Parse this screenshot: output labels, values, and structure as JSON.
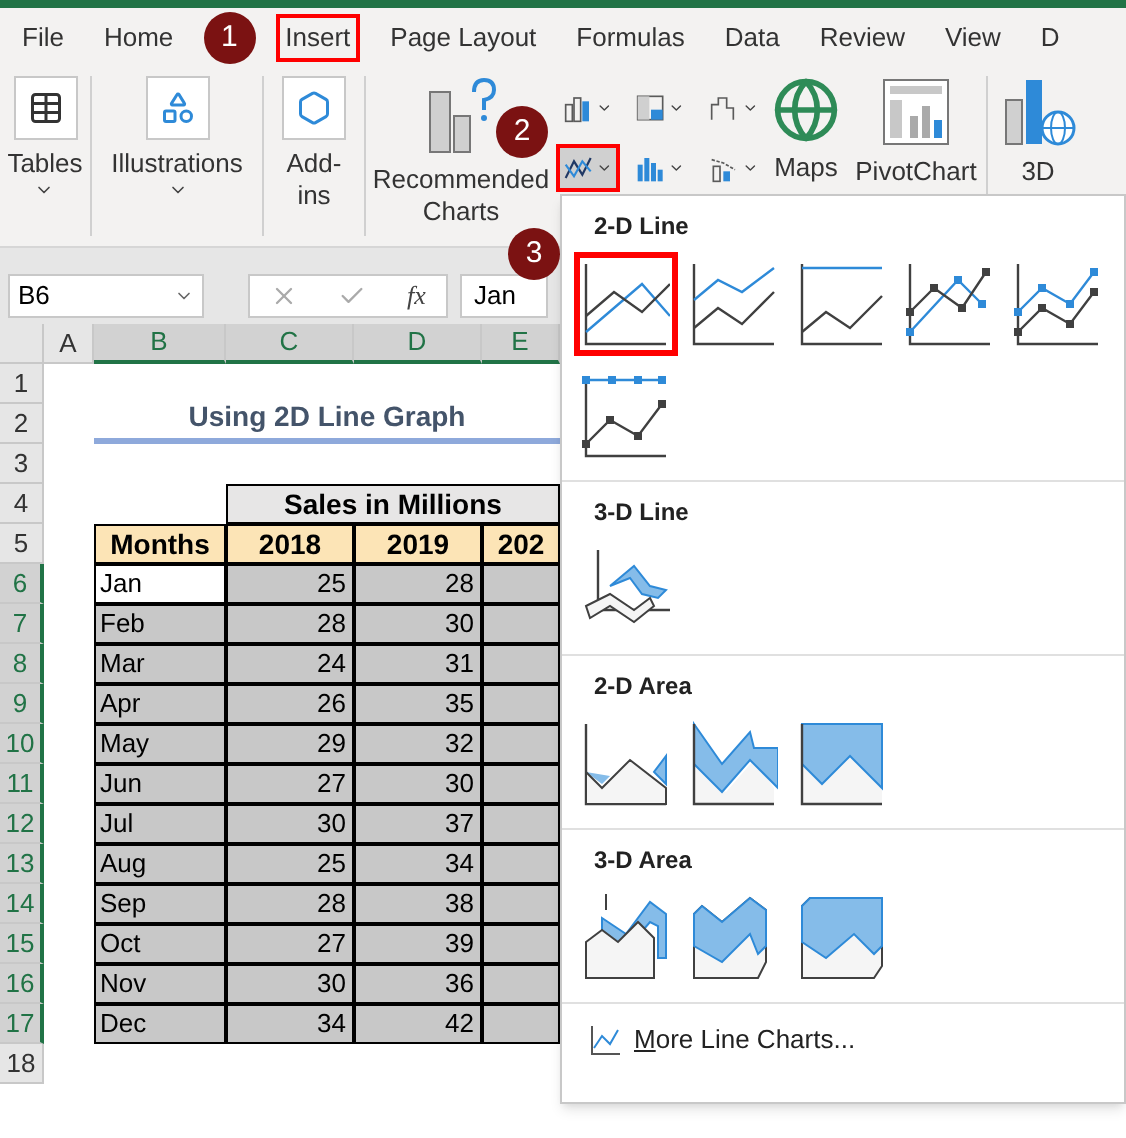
{
  "tabs": [
    {
      "label": "File",
      "selected": false
    },
    {
      "label": "Home",
      "selected": false
    },
    {
      "label": "Insert",
      "selected": true
    },
    {
      "label": "Page Layout",
      "selected": false
    },
    {
      "label": "Formulas",
      "selected": false
    },
    {
      "label": "Data",
      "selected": false
    },
    {
      "label": "Review",
      "selected": false
    },
    {
      "label": "View",
      "selected": false
    },
    {
      "label": "D",
      "selected": false
    }
  ],
  "ribbon": {
    "tables": {
      "label": "Tables"
    },
    "illustrations": {
      "label": "Illustrations"
    },
    "addins": {
      "label": "Add-\nins"
    },
    "recommended": {
      "label": "Recommended\nCharts"
    },
    "small_charts": [
      {
        "kind": "column",
        "selected": false
      },
      {
        "kind": "hierarchy",
        "selected": false
      },
      {
        "kind": "waterfall",
        "selected": false
      },
      {
        "kind": "line",
        "selected": true
      },
      {
        "kind": "statistic",
        "selected": false
      },
      {
        "kind": "scatter",
        "selected": false
      }
    ],
    "maps": {
      "label": "Maps"
    },
    "pivotchart": {
      "label": "PivotChart"
    },
    "three_d": {
      "label": "3D"
    }
  },
  "callouts": [
    "1",
    "2",
    "3"
  ],
  "formula_bar": {
    "name_box": "B6",
    "function_label": "fx",
    "content": "Jan"
  },
  "columns": [
    {
      "label": "A",
      "selected": false
    },
    {
      "label": "B",
      "selected": true
    },
    {
      "label": "C",
      "selected": true
    },
    {
      "label": "D",
      "selected": true
    },
    {
      "label": "E",
      "selected": true
    }
  ],
  "row_numbers": [
    {
      "label": "1",
      "selected": false
    },
    {
      "label": "2",
      "selected": false
    },
    {
      "label": "3",
      "selected": false
    },
    {
      "label": "4",
      "selected": false
    },
    {
      "label": "5",
      "selected": false
    },
    {
      "label": "6",
      "selected": true
    },
    {
      "label": "7",
      "selected": true
    },
    {
      "label": "8",
      "selected": true
    },
    {
      "label": "9",
      "selected": true
    },
    {
      "label": "10",
      "selected": true
    },
    {
      "label": "11",
      "selected": true
    },
    {
      "label": "12",
      "selected": true
    },
    {
      "label": "13",
      "selected": true
    },
    {
      "label": "14",
      "selected": true
    },
    {
      "label": "15",
      "selected": true
    },
    {
      "label": "16",
      "selected": true
    },
    {
      "label": "17",
      "selected": true
    },
    {
      "label": "18",
      "selected": false
    }
  ],
  "sheet_title": "Using 2D Line Graph",
  "group_header": "Sales in Millions",
  "headers": [
    "Months",
    "2018",
    "2019",
    "202"
  ],
  "rows": [
    {
      "month": "Jan",
      "values": [
        "25",
        "28"
      ],
      "active": true
    },
    {
      "month": "Feb",
      "values": [
        "28",
        "30"
      ],
      "active": false
    },
    {
      "month": "Mar",
      "values": [
        "24",
        "31"
      ],
      "active": false
    },
    {
      "month": "Apr",
      "values": [
        "26",
        "35"
      ],
      "active": false
    },
    {
      "month": "May",
      "values": [
        "29",
        "32"
      ],
      "active": false
    },
    {
      "month": "Jun",
      "values": [
        "27",
        "30"
      ],
      "active": false
    },
    {
      "month": "Jul",
      "values": [
        "30",
        "37"
      ],
      "active": false
    },
    {
      "month": "Aug",
      "values": [
        "25",
        "34"
      ],
      "active": false
    },
    {
      "month": "Sep",
      "values": [
        "28",
        "38"
      ],
      "active": false
    },
    {
      "month": "Oct",
      "values": [
        "27",
        "39"
      ],
      "active": false
    },
    {
      "month": "Nov",
      "values": [
        "30",
        "36"
      ],
      "active": false
    },
    {
      "month": "Dec",
      "values": [
        "34",
        "42"
      ],
      "active": false
    }
  ],
  "dropdown": {
    "sections": [
      {
        "title": "2-D Line",
        "charts": [
          {
            "kind": "line",
            "selected": true
          },
          {
            "kind": "stacked_line",
            "selected": false
          },
          {
            "kind": "stacked_line_100",
            "selected": false
          },
          {
            "kind": "line_markers",
            "selected": false
          },
          {
            "kind": "stacked_line_markers",
            "selected": false
          },
          {
            "kind": "stacked_line_100_markers",
            "selected": false
          }
        ]
      },
      {
        "title": "3-D Line",
        "charts": [
          {
            "kind": "line_3d",
            "selected": false
          }
        ]
      },
      {
        "title": "2-D Area",
        "charts": [
          {
            "kind": "area",
            "selected": false
          },
          {
            "kind": "stacked_area",
            "selected": false
          },
          {
            "kind": "stacked_area_100",
            "selected": false
          }
        ]
      },
      {
        "title": "3-D Area",
        "charts": [
          {
            "kind": "area_3d",
            "selected": false
          },
          {
            "kind": "stacked_area_3d",
            "selected": false
          },
          {
            "kind": "stacked_area_100_3d",
            "selected": false
          }
        ]
      }
    ],
    "footer": "More Line Charts..."
  }
}
